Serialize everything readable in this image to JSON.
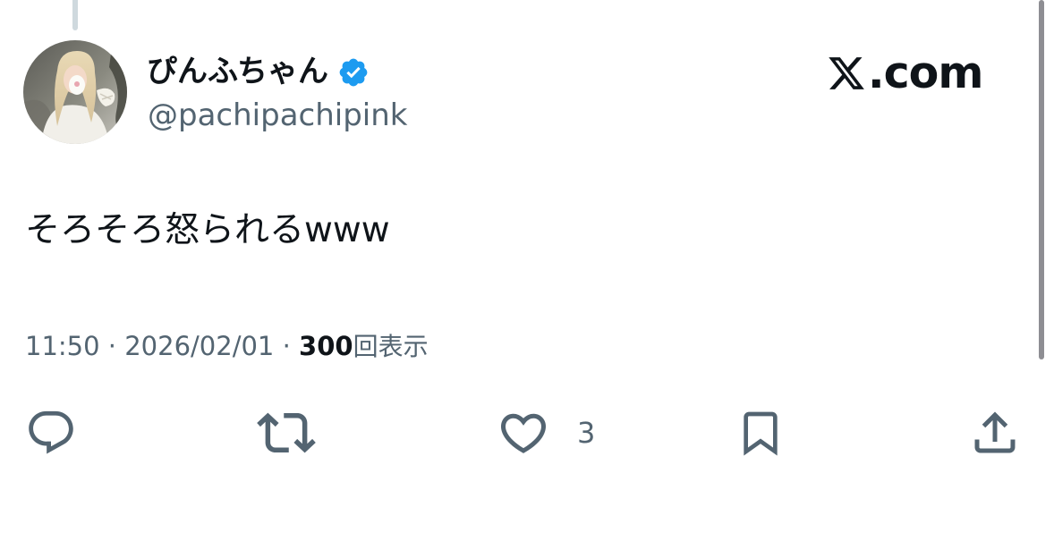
{
  "post": {
    "author": {
      "display_name": "ぴんふちゃん",
      "handle": "@pachipachipink",
      "verified": true
    },
    "brand": {
      "logo_text": ".com",
      "logo_icon": "x-logo-icon"
    },
    "text": "そろそろ怒られるwww",
    "meta": {
      "time": "11:50",
      "separator": "·",
      "date": "2026/02/01",
      "views_count": "300",
      "views_label": "回表示"
    },
    "actions": {
      "reply_icon": "reply-icon",
      "repost_icon": "repost-icon",
      "like_icon": "heart-icon",
      "like_count": "3",
      "bookmark_icon": "bookmark-icon",
      "share_icon": "share-icon"
    }
  },
  "colors": {
    "text_primary": "#0f1419",
    "text_secondary": "#536471",
    "verified_blue": "#1d9bf0",
    "thread_line": "#cfd9de"
  }
}
